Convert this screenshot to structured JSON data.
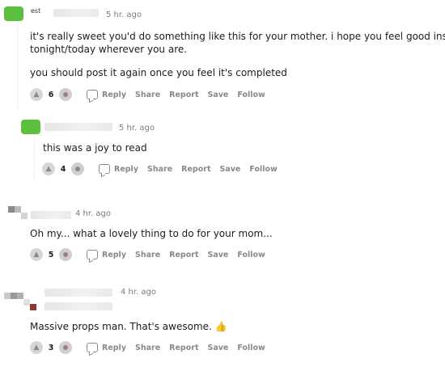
{
  "comments": [
    {
      "username_fragment": "est",
      "time": "5 hr. ago",
      "paragraphs": [
        "it's really sweet you'd do something like this for your mother. i hope you feel good inside",
        "tonight/today wherever you are.",
        "you should post it again once you feel it's completed"
      ],
      "score": "6",
      "actions": [
        "Reply",
        "Share",
        "Report",
        "Save",
        "Follow"
      ]
    },
    {
      "time": "5 hr. ago",
      "paragraphs": [
        "this was a joy to read"
      ],
      "score": "4",
      "actions": [
        "Reply",
        "Share",
        "Report",
        "Save",
        "Follow"
      ]
    },
    {
      "time": "4 hr. ago",
      "paragraphs": [
        "Oh my... what a lovely thing to do for your mom..."
      ],
      "score": "5",
      "actions": [
        "Reply",
        "Share",
        "Report",
        "Save",
        "Follow"
      ]
    },
    {
      "time": "4 hr. ago",
      "paragraphs": [
        "Massive props man. That's awesome."
      ],
      "emoji": "👍",
      "score": "3",
      "actions": [
        "Reply",
        "Share",
        "Report",
        "Save",
        "Follow"
      ]
    }
  ],
  "colors": {
    "avatar_green": "#5cbf3f",
    "meta_gray": "#878a8c",
    "text": "#1c1c1c"
  },
  "icons": {
    "upvote": "upvote-icon",
    "downvote": "downvote-icon",
    "comment": "comment-icon"
  }
}
